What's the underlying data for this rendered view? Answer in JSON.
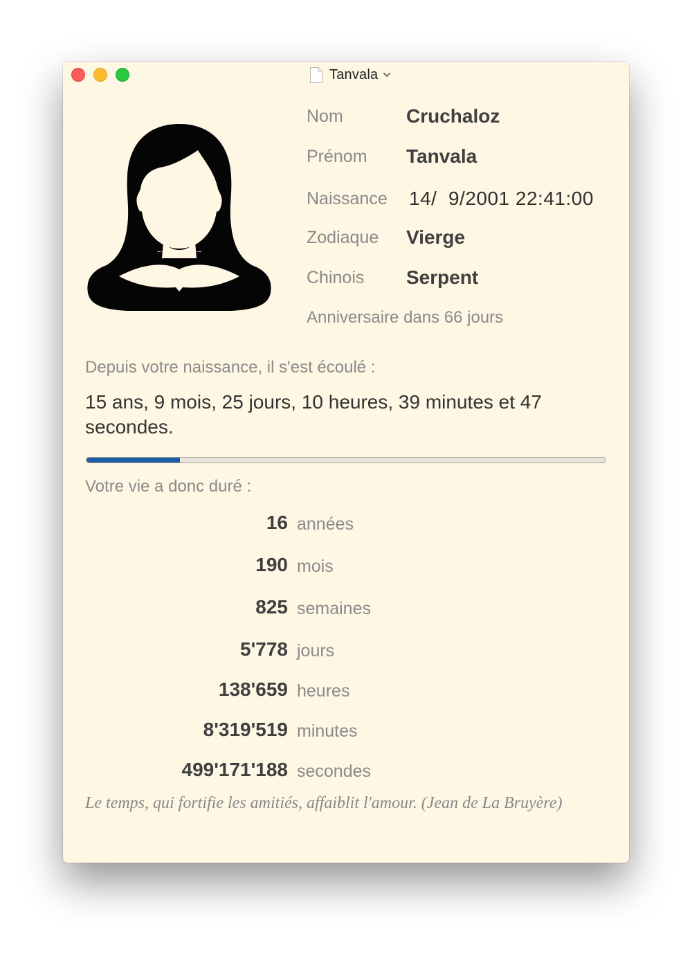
{
  "window": {
    "title": "Tanvala"
  },
  "profile": {
    "rows": [
      {
        "label": "Nom",
        "value": "Cruchaloz"
      },
      {
        "label": "Prénom",
        "value": "Tanvala"
      },
      {
        "label": "Naissance",
        "value": "14/  9/2001 22:41:00"
      },
      {
        "label": "Zodiaque",
        "value": "Vierge"
      },
      {
        "label": "Chinois",
        "value": "Serpent"
      }
    ],
    "birthday_text": "Anniversaire dans 66 jours"
  },
  "elapsed": {
    "label": "Depuis votre naissance, il s'est écoulé :",
    "text": "15 ans, 9 mois, 25 jours, 10 heures, 39 minutes et 47 secondes.",
    "progress_fraction": 0.18
  },
  "life": {
    "label": "Votre vie a donc duré :",
    "stats": [
      {
        "value": "16",
        "unit": "années"
      },
      {
        "value": "190",
        "unit": "mois"
      },
      {
        "value": "825",
        "unit": "semaines"
      },
      {
        "value": "5'778",
        "unit": "jours"
      },
      {
        "value": "138'659",
        "unit": "heures"
      },
      {
        "value": "8'319'519",
        "unit": "minutes"
      },
      {
        "value": "499'171'188",
        "unit": "secondes"
      }
    ]
  },
  "quote": "Le temps, qui fortifie les amitiés, affaiblit l'amour. (Jean de La Bruyère)",
  "colors": {
    "window_background": "#fdf7e3",
    "progress_fill": "#1d5ca7",
    "close_button": "#fc5b57",
    "minimize_button": "#fdbb2e",
    "zoom_button": "#29c83f"
  },
  "icons": {
    "avatar": "female-avatar-silhouette-icon",
    "document": "document-icon",
    "title_menu": "chevron-down-icon"
  }
}
